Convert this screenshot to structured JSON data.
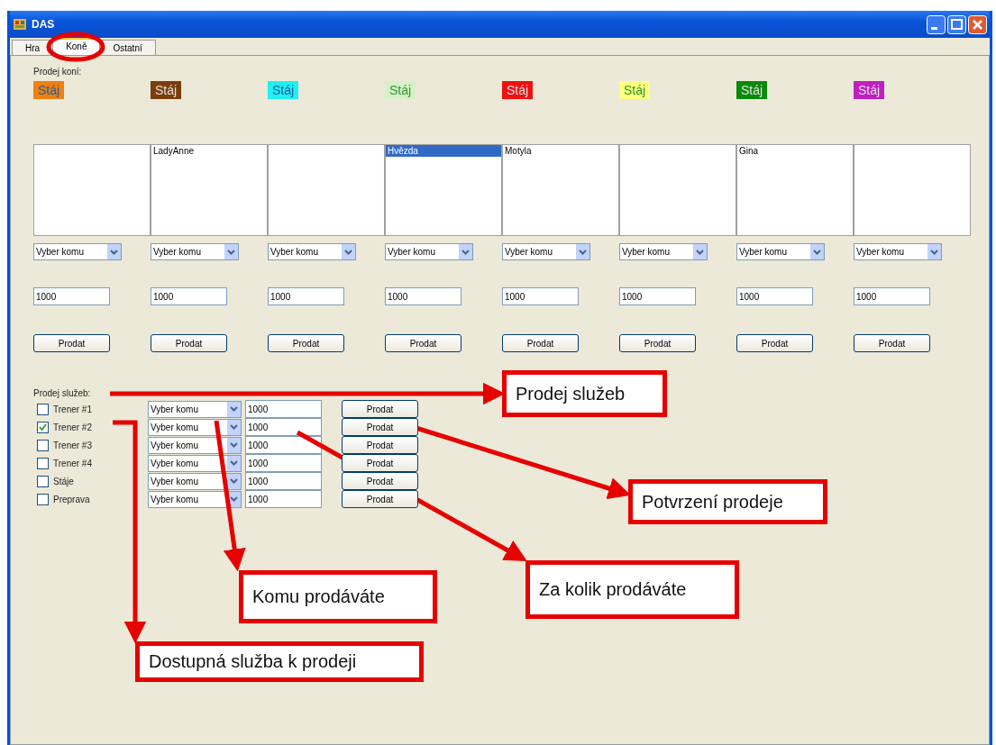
{
  "window": {
    "title": "DAS"
  },
  "tabs": [
    {
      "label": "Hra",
      "selected": false
    },
    {
      "label": "Koně",
      "selected": true
    },
    {
      "label": "Ostatní",
      "selected": false
    }
  ],
  "horse_sale": {
    "label": "Prodej koní:",
    "columns": [
      {
        "stable": "Stáj",
        "color": "#f08010",
        "buyer": "Vyber komu",
        "price": "1000",
        "button": "Prodat"
      },
      {
        "stable": "Stáj",
        "color": "#7a3e0a",
        "horses": [
          {
            "name": "LadyAnne",
            "selected": false
          }
        ],
        "buyer": "Vyber komu",
        "price": "1000",
        "button": "Prodat"
      },
      {
        "stable": "Stáj",
        "color": "#20f0f0",
        "buyer": "Vyber komu",
        "price": "1000",
        "button": "Prodat"
      },
      {
        "stable": "Stáj",
        "color": "#d8f0c8",
        "horses": [
          {
            "name": "Hvězda",
            "selected": true
          }
        ],
        "buyer": "Vyber komu",
        "price": "1000",
        "button": "Prodat"
      },
      {
        "stable": "Stáj",
        "color": "#f01010",
        "horses": [
          {
            "name": "Motyla",
            "selected": false
          }
        ],
        "buyer": "Vyber komu",
        "price": "1000",
        "button": "Prodat"
      },
      {
        "stable": "Stáj",
        "color": "#ffff80",
        "buyer": "Vyber komu",
        "price": "1000",
        "button": "Prodat"
      },
      {
        "stable": "Stáj",
        "color": "#0a8a0a",
        "horses": [
          {
            "name": "Gina",
            "selected": false
          }
        ],
        "buyer": "Vyber komu",
        "price": "1000",
        "button": "Prodat"
      },
      {
        "stable": "Stáj",
        "color": "#c020c0",
        "buyer": "Vyber komu",
        "price": "1000",
        "button": "Prodat"
      }
    ]
  },
  "service_sale": {
    "label": "Prodej služeb:",
    "services": [
      {
        "label": "Trener #1",
        "checked": false,
        "buyer": "Vyber komu",
        "price": "1000",
        "button": "Prodat"
      },
      {
        "label": "Trener #2",
        "checked": true,
        "buyer": "Vyber komu",
        "price": "1000",
        "button": "Prodat"
      },
      {
        "label": "Trener #3",
        "checked": false,
        "buyer": "Vyber komu",
        "price": "1000",
        "button": "Prodat"
      },
      {
        "label": "Trener #4",
        "checked": false,
        "buyer": "Vyber komu",
        "price": "1000",
        "button": "Prodat"
      },
      {
        "label": "Stáje",
        "checked": false,
        "buyer": "Vyber komu",
        "price": "1000",
        "button": "Prodat"
      },
      {
        "label": "Preprava",
        "checked": false,
        "buyer": "Vyber komu",
        "price": "1000",
        "button": "Prodat"
      }
    ]
  },
  "annotations": [
    {
      "text": "Prodej služeb"
    },
    {
      "text": "Potvrzení prodeje"
    },
    {
      "text": "Komu prodáváte"
    },
    {
      "text": "Za kolik prodáváte"
    },
    {
      "text": "Dostupná služba k prodeji"
    }
  ]
}
